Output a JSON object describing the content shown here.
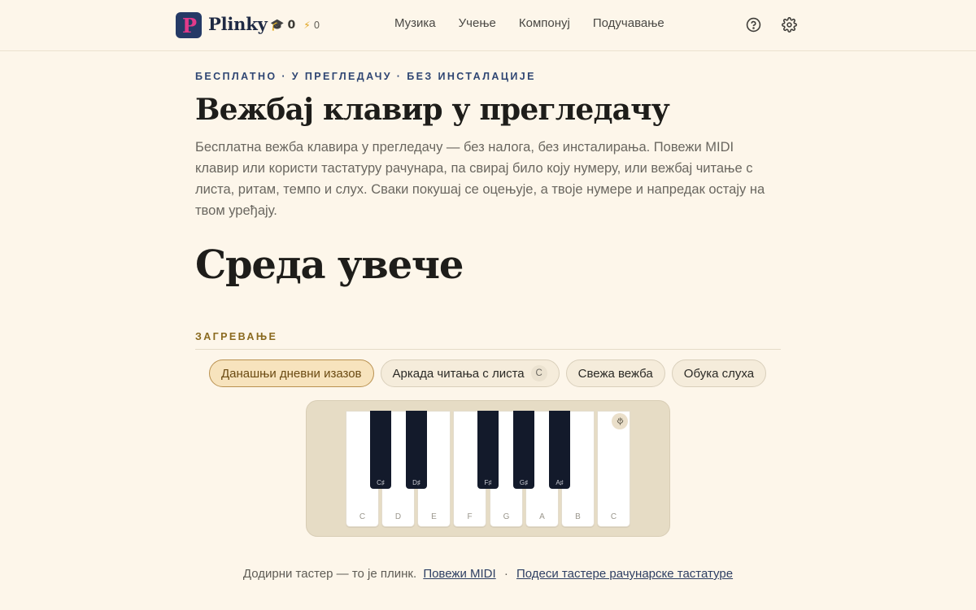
{
  "header": {
    "logo_letter": "P",
    "brand": "Plinky",
    "streak_value": "0",
    "energy_value": "0",
    "nav": [
      "Музика",
      "Учење",
      "Компонуј",
      "Подучавање"
    ],
    "icons": {
      "help": "help-circle-icon",
      "settings": "gear-icon"
    }
  },
  "hero": {
    "eyebrow": "БЕСПЛАТНО · У ПРЕГЛЕДАЧУ · БЕЗ ИНСТАЛАЦИЈЕ",
    "title": "Вежбај клавир у прегледачу",
    "lede": "Бесплатна вежба клавира у прегледачу — без налога, без инсталирања. Повежи MIDI клавир или користи тастатуру рачунара, па свирај било коју нумеру, или вежбај читање с листа, ритам, темпо и слух. Сваки покушај се оцењује, а твоје нумере и напредак остају на твом уређају.",
    "greeting": "Среда увече"
  },
  "warmup": {
    "label": "ЗАГРЕВАЊЕ",
    "chips": [
      {
        "label": "Данашњи дневни изазов",
        "active": true
      },
      {
        "label": "Аркада читања с листа",
        "badge": "C"
      },
      {
        "label": "Свежа вежба"
      },
      {
        "label": "Обука слуха"
      }
    ]
  },
  "piano": {
    "white_keys": [
      "C",
      "D",
      "E",
      "F",
      "G",
      "A",
      "B",
      "C"
    ],
    "black_keys": [
      "C♯",
      "D♯",
      "F♯",
      "G♯",
      "A♯"
    ],
    "mic_icon": "microphone-icon"
  },
  "footer": {
    "hint": "Додирни тастер — то је плинк.",
    "connect_midi": "Повежи MIDI",
    "separator": "·",
    "configure_keys": "Подеси тастере рачунарске тастатуре"
  },
  "colors": {
    "background": "#fdf6ea",
    "brand_navy": "#253a66",
    "brand_pink": "#e23a8a",
    "accent_gold": "#8a6a1f",
    "chip_active_bg": "#f7e3bd"
  }
}
